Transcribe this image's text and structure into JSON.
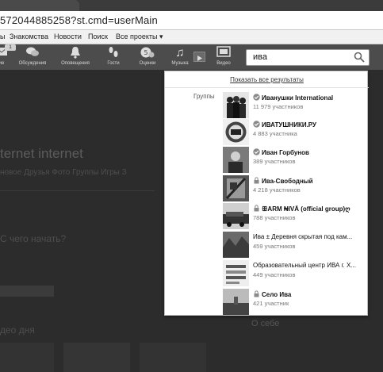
{
  "browser": {
    "url": "5720448852​58?st.cmd=userMain"
  },
  "menu": {
    "items": [
      "ы",
      "Знакомства",
      "Новости",
      "Поиск",
      "Все проекты ▾"
    ]
  },
  "toolbar": {
    "badge": "1",
    "items": [
      {
        "label": "ие",
        "icon": "envelope-icon"
      },
      {
        "label": "Обсуждения",
        "icon": "chat-bubbles-icon"
      },
      {
        "label": "Оповещения",
        "icon": "bell-icon"
      },
      {
        "label": "Гости",
        "icon": "footprints-icon"
      },
      {
        "label": "Оценки",
        "icon": "rating-icon"
      },
      {
        "label": "Музыка",
        "icon": "music-note-icon"
      },
      {
        "label": "Видео",
        "icon": "video-icon"
      }
    ]
  },
  "search": {
    "query": "ива"
  },
  "background_page": {
    "name": "ternet internet",
    "tabs_text": "новое  Друзья  Фото  Группы  Игры  З",
    "what_start": "С чего начать?",
    "video_day": "део дня",
    "about": "О себе"
  },
  "dropdown": {
    "show_all": "Показать все результаты",
    "section_label": "Группы",
    "groups": [
      {
        "name": "Иванушки International",
        "members": "11 979 участников",
        "status": "verified"
      },
      {
        "name": "ИВАТУШНИКИ.РУ",
        "members": "4 883 участника",
        "status": "verified"
      },
      {
        "name": "Иван Горбунов",
        "members": "389 участников",
        "status": "verified"
      },
      {
        "name": "Ива-Свободный",
        "members": "4 218 участников",
        "status": "locked"
      },
      {
        "name": "ꕥARM ₦IVÄ (official group)ღ",
        "members": "788 участников",
        "status": "locked"
      },
      {
        "name": "Ива ± Деревня скрытая под кам...",
        "members": "459 участников",
        "status": "none"
      },
      {
        "name": "Образовательный центр ИВА г. Х...",
        "members": "449 участников",
        "status": "none"
      },
      {
        "name": "Село Ива",
        "members": "421 участник",
        "status": "locked"
      }
    ]
  },
  "colors": {
    "toolbar_bg": "#4c4c4c",
    "page_bg": "#2c2c2c",
    "dropdown_bg": "#ffffff"
  }
}
